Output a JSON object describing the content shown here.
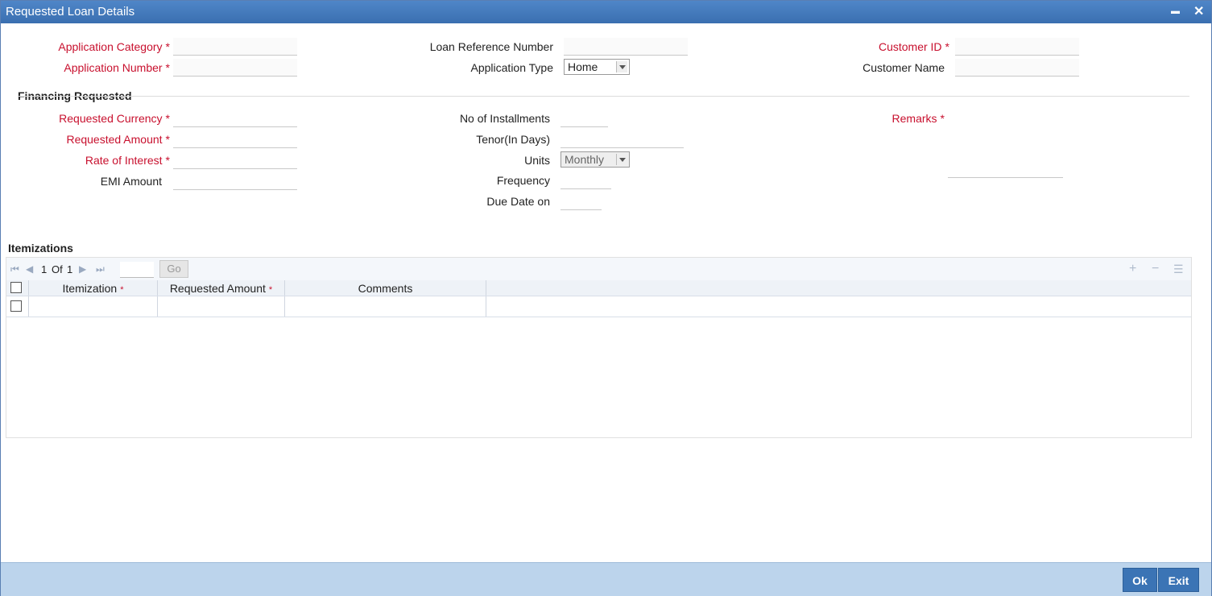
{
  "window": {
    "title": "Requested Loan Details",
    "minimize_glyph": "▬",
    "close_glyph": "✕"
  },
  "header": {
    "application_category_label": "Application Category",
    "application_number_label": "Application Number",
    "loan_reference_label": "Loan Reference Number",
    "application_type_label": "Application Type",
    "application_type_value": "Home",
    "customer_id_label": "Customer ID",
    "customer_name_label": "Customer Name",
    "required_mark": "*"
  },
  "financing": {
    "section_title": "Financing Requested",
    "requested_currency_label": "Requested Currency",
    "requested_amount_label": "Requested Amount",
    "rate_of_interest_label": "Rate of Interest",
    "emi_amount_label": "EMI Amount",
    "no_of_installments_label": "No of Installments",
    "tenor_label": "Tenor(In Days)",
    "units_label": "Units",
    "units_value": "Monthly",
    "frequency_label": "Frequency",
    "due_date_label": "Due Date on",
    "remarks_label": "Remarks"
  },
  "itemizations": {
    "section_title": "Itemizations",
    "pager": {
      "page": "1",
      "of_label": "Of",
      "total": "1",
      "go_label": "Go"
    },
    "columns": [
      "Itemization",
      "Requested Amount",
      "Comments"
    ]
  },
  "footer": {
    "ok_label": "Ok",
    "exit_label": "Exit"
  }
}
